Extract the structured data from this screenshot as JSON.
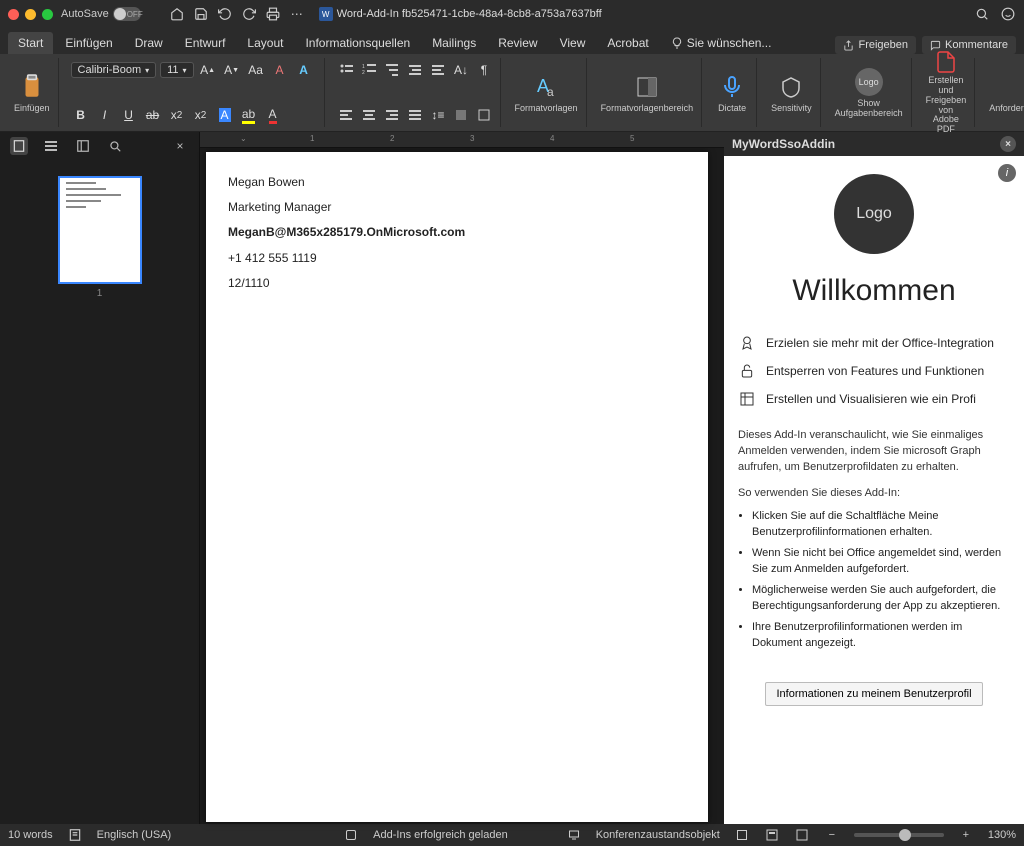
{
  "titlebar": {
    "autosave_label": "AutoSave",
    "autosave_state": "OFF",
    "doc_title": "Word-Add-In fb525471-1cbe-48a4-8cb8-a753a7637bff"
  },
  "tabs": {
    "items": [
      "Start",
      "Einfügen",
      "Draw",
      "Entwurf",
      "Layout",
      "Informationsquellen",
      "Mailings",
      "Review",
      "View",
      "Acrobat"
    ],
    "active": 0,
    "tellme_prefix": "Sie wünschen...",
    "share": "Freigeben",
    "comments": "Kommentare"
  },
  "ribbon": {
    "paste": "Einfügen",
    "font_name": "Calibri-Boom",
    "font_size": "11",
    "styles1": "Formatvorlagen",
    "styles2": "Formatvorlagenbereich",
    "dictate": "Dictate",
    "sensitivity": "Sensitivity",
    "show": "Show Aufgabenbereich",
    "createshare": "Erstellen und Freigeben von Adobe PDF",
    "signatures": "Anforderungssignaturen"
  },
  "nav": {
    "page_number": "1"
  },
  "page_lines": [
    "Megan Bowen",
    "Marketing Manager",
    "MeganB@M365x285179.OnMicrosoft.com",
    "+1 412 555 1119",
    "12/1110"
  ],
  "taskpane": {
    "title": "MyWordSsoAddin",
    "logo": "Logo",
    "heading": "Willkommen",
    "features": [
      "Erzielen sie mehr mit der Office-Integration",
      "Entsperren von Features und Funktionen",
      "Erstellen und Visualisieren wie ein Profi"
    ],
    "para1": "Dieses Add-In veranschaulicht, wie Sie einmaliges Anmelden verwenden, indem Sie microsoft Graph aufrufen, um Benutzerprofildaten zu erhalten.",
    "para2": "So verwenden Sie dieses Add-In:",
    "steps": [
      "Klicken Sie auf die Schaltfläche Meine Benutzerprofilinformationen erhalten.",
      "Wenn Sie nicht bei Office angemeldet sind, werden Sie zum Anmelden aufgefordert.",
      "Möglicherweise werden Sie auch aufgefordert, die Berechtigungsanforderung der App zu akzeptieren.",
      "Ihre Benutzerprofilinformationen werden im Dokument angezeigt."
    ],
    "button": "Informationen zu meinem Benutzerprofil"
  },
  "status": {
    "words": "10 words",
    "language": "Englisch (USA)",
    "addins": "Add-Ins erfolgreich geladen",
    "conf": "Konferenzaustandsobjekt",
    "zoom": "130%"
  }
}
